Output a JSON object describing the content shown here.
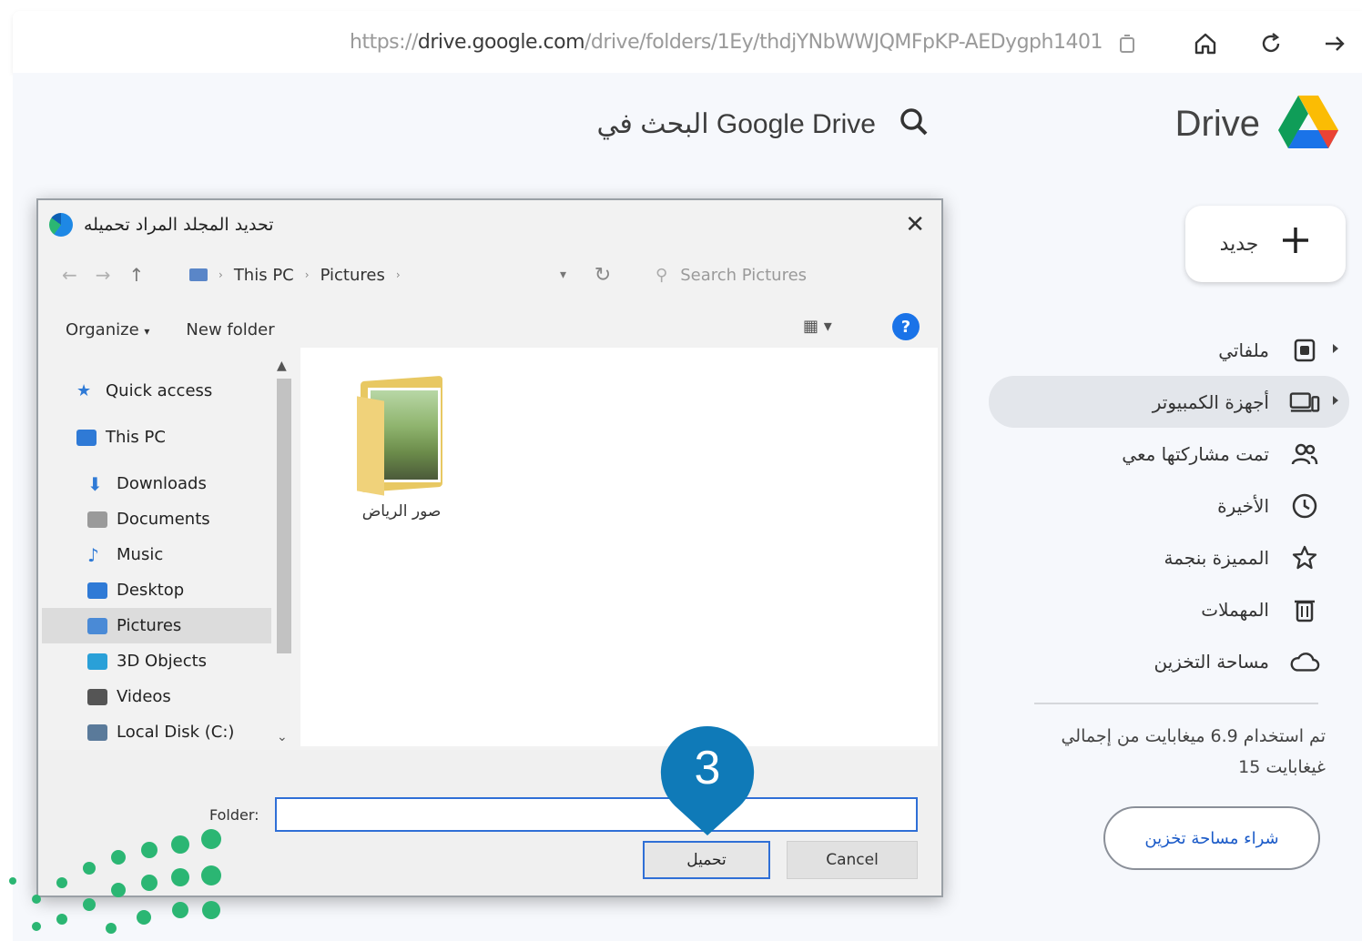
{
  "browser": {
    "url_prefix": "https://",
    "url_domain": "drive.google.com",
    "url_path": "/drive/folders/1Ey/thdjYNbWWJQMFpKP-AEDygph1401"
  },
  "drive": {
    "search_placeholder": "البحث في Google Drive",
    "logo_text": "Drive",
    "new_button_label": "جديد",
    "nav": [
      {
        "label": "ملفاتي",
        "icon": "my-drive-icon",
        "has_arrow": true
      },
      {
        "label": "أجهزة الكمبيوتر",
        "icon": "computers-icon",
        "has_arrow": true,
        "active": true
      },
      {
        "label": "تمت مشاركتها معي",
        "icon": "shared-icon"
      },
      {
        "label": "الأخيرة",
        "icon": "clock-icon"
      },
      {
        "label": "المميزة بنجمة",
        "icon": "star-icon"
      },
      {
        "label": "المهملات",
        "icon": "trash-icon"
      },
      {
        "label": "مساحة التخزين",
        "icon": "cloud-icon"
      }
    ],
    "storage_line1": "تم استخدام 6.9 ميغابايت من إجمالي",
    "storage_line2": "15 غيغابايت",
    "storage_button": "شراء مساحة تخزين"
  },
  "dialog": {
    "title": "تحديد المجلد المراد تحميله",
    "breadcrumb": [
      "This PC",
      "Pictures"
    ],
    "search_placeholder": "Search Pictures",
    "organize_label": "Organize",
    "new_folder_label": "New folder",
    "tree": [
      {
        "label": "Quick access",
        "icon": "star-icon",
        "indent": 0,
        "color": "#2f7ad6"
      },
      {
        "label": "This PC",
        "icon": "computer-icon",
        "indent": 0,
        "color": "#2f7ad6"
      },
      {
        "label": "Downloads",
        "icon": "download-icon",
        "indent": 1,
        "color": "#2f7ad6"
      },
      {
        "label": "Documents",
        "icon": "document-icon",
        "indent": 1,
        "color": "#9a9a9a"
      },
      {
        "label": "Music",
        "icon": "music-icon",
        "indent": 1,
        "color": "#2f7ad6"
      },
      {
        "label": "Desktop",
        "icon": "desktop-icon",
        "indent": 1,
        "color": "#2f7ad6"
      },
      {
        "label": "Pictures",
        "icon": "pictures-icon",
        "indent": 1,
        "color": "#4a8ad6",
        "selected": true
      },
      {
        "label": "3D Objects",
        "icon": "cube-icon",
        "indent": 1,
        "color": "#2aa0d8"
      },
      {
        "label": "Videos",
        "icon": "video-icon",
        "indent": 1,
        "color": "#555555"
      },
      {
        "label": "Local Disk (C:)",
        "icon": "disk-icon",
        "indent": 1,
        "color": "#5a7a9a"
      }
    ],
    "folder_item": "صور الرياض",
    "folder_field_label": "Folder:",
    "folder_field_value": "",
    "ok_button": "تحميل",
    "cancel_button": "Cancel"
  },
  "step_marker": "3",
  "colors": {
    "accent": "#1a73e8",
    "marker": "#0f7ab8",
    "dots": "#2bb673"
  }
}
